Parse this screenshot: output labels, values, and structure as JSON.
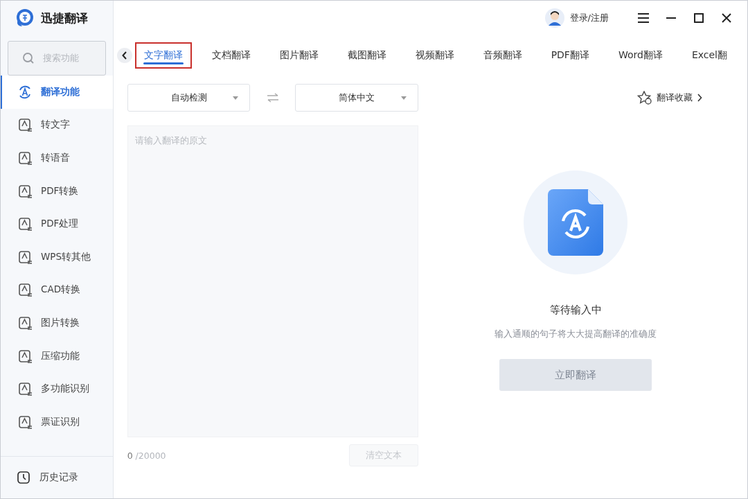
{
  "app": {
    "name": "迅捷翻译"
  },
  "search": {
    "placeholder": "搜索功能"
  },
  "sidebar": {
    "items": [
      {
        "label": "翻译功能",
        "selected": true
      },
      {
        "label": "转文字",
        "selected": false
      },
      {
        "label": "转语音",
        "selected": false
      },
      {
        "label": "PDF转换",
        "selected": false
      },
      {
        "label": "PDF处理",
        "selected": false
      },
      {
        "label": "WPS转其他",
        "selected": false
      },
      {
        "label": "CAD转换",
        "selected": false
      },
      {
        "label": "图片转换",
        "selected": false
      },
      {
        "label": "压缩功能",
        "selected": false
      },
      {
        "label": "多功能识别",
        "selected": false
      },
      {
        "label": "票证识别",
        "selected": false
      }
    ],
    "footer": {
      "label": "历史记录"
    }
  },
  "header": {
    "login": "登录/注册"
  },
  "tabs": [
    {
      "label": "文字翻译",
      "selected": true
    },
    {
      "label": "文档翻译",
      "selected": false
    },
    {
      "label": "图片翻译",
      "selected": false
    },
    {
      "label": "截图翻译",
      "selected": false
    },
    {
      "label": "视频翻译",
      "selected": false
    },
    {
      "label": "音频翻译",
      "selected": false
    },
    {
      "label": "PDF翻译",
      "selected": false
    },
    {
      "label": "Word翻译",
      "selected": false
    },
    {
      "label": "Excel翻",
      "selected": false
    }
  ],
  "source_language": "自动检测",
  "target_language": "简体中文",
  "favorites": "翻译收藏",
  "input": {
    "placeholder": "请输入翻译的原文",
    "count": "0",
    "limit": "/20000"
  },
  "clear_button": "清空文本",
  "status": {
    "title": "等待输入中",
    "hint": "输入通顺的句子将大大提高翻译的准确度"
  },
  "translate_button": {
    "label": "立即翻译",
    "disabled": true
  }
}
